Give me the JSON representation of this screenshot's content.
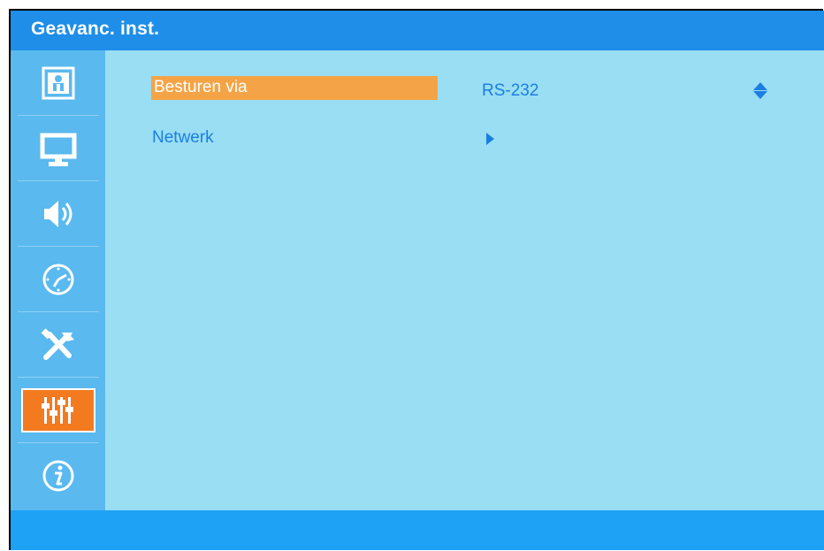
{
  "header": {
    "title": "Geavanc. inst."
  },
  "sidebar": {
    "items": [
      {
        "icon": "picture-icon",
        "active": false
      },
      {
        "icon": "monitor-icon",
        "active": false
      },
      {
        "icon": "speaker-icon",
        "active": false
      },
      {
        "icon": "clock-icon",
        "active": false
      },
      {
        "icon": "tools-icon",
        "active": false
      },
      {
        "icon": "sliders-icon",
        "active": true
      },
      {
        "icon": "info-icon",
        "active": false
      }
    ]
  },
  "menu": {
    "rows": [
      {
        "label": "Besturen via",
        "value": "RS-232",
        "control": "up-down",
        "selected": true
      },
      {
        "label": "Netwerk",
        "value": "",
        "control": "submenu-arrow",
        "selected": false
      }
    ]
  },
  "colors": {
    "titlebar": "#1e8ee8",
    "sidebar": "#5ab9ee",
    "content": "#9adef4",
    "footer": "#1ea2f5",
    "highlight": "#f4a446",
    "active_icon": "#f47a20",
    "text": "#1a7fe0"
  }
}
